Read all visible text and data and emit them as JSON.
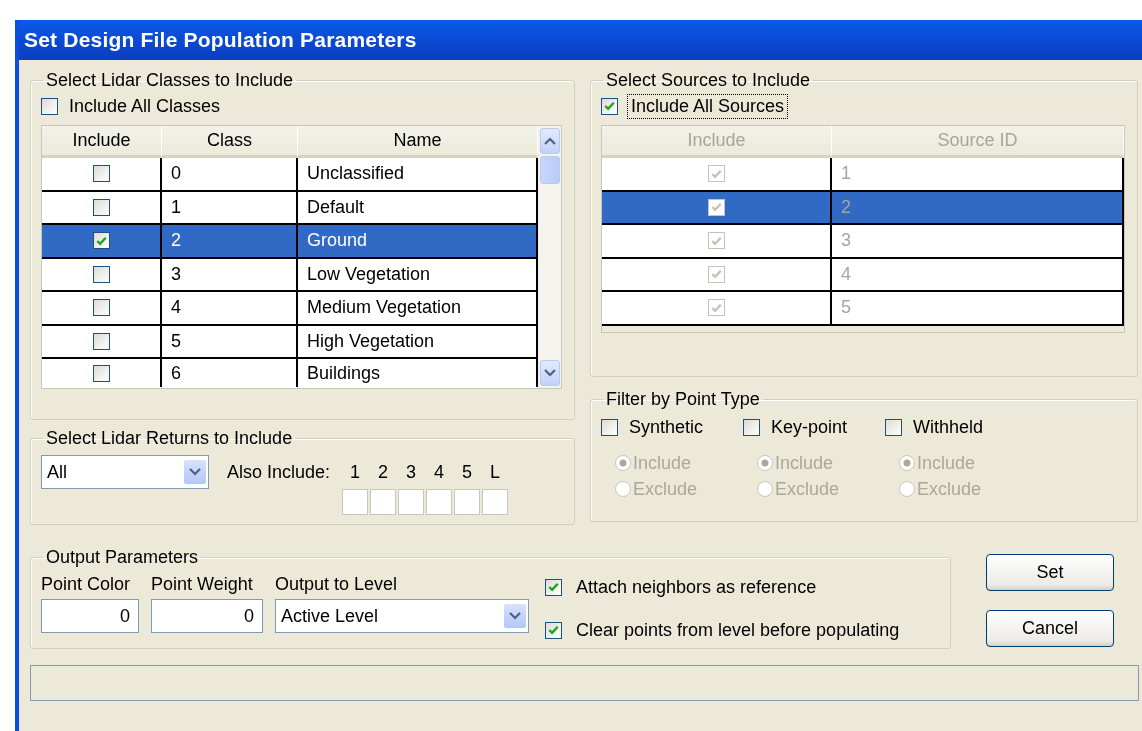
{
  "window": {
    "title": "Set Design File Population Parameters"
  },
  "classes_group": {
    "title": "Select Lidar Classes to Include",
    "include_all": {
      "label": "Include All Classes",
      "checked": false
    },
    "table": {
      "columns": [
        "Include",
        "Class",
        "Name"
      ],
      "rows": [
        {
          "include": false,
          "class": "0",
          "name": "Unclassified",
          "selected": false
        },
        {
          "include": false,
          "class": "1",
          "name": "Default",
          "selected": false
        },
        {
          "include": true,
          "class": "2",
          "name": "Ground",
          "selected": true
        },
        {
          "include": false,
          "class": "3",
          "name": "Low Vegetation",
          "selected": false
        },
        {
          "include": false,
          "class": "4",
          "name": "Medium Vegetation",
          "selected": false
        },
        {
          "include": false,
          "class": "5",
          "name": "High Vegetation",
          "selected": false
        },
        {
          "include": false,
          "class": "6",
          "name": "Buildings",
          "selected": false
        }
      ]
    }
  },
  "sources_group": {
    "title": "Select Sources to Include",
    "include_all": {
      "label": "Include All Sources",
      "checked": true,
      "focused": true
    },
    "table": {
      "disabled": true,
      "columns": [
        "Include",
        "Source ID"
      ],
      "rows": [
        {
          "include": true,
          "source_id": "1",
          "selected": false
        },
        {
          "include": true,
          "source_id": "2",
          "selected": true
        },
        {
          "include": true,
          "source_id": "3",
          "selected": false
        },
        {
          "include": true,
          "source_id": "4",
          "selected": false
        },
        {
          "include": true,
          "source_id": "5",
          "selected": false
        }
      ]
    }
  },
  "returns_group": {
    "title": "Select Lidar Returns to Include",
    "dropdown": {
      "value": "All"
    },
    "also_label": "Also Include:",
    "returns": [
      {
        "label": "1",
        "checked": false,
        "disabled": true
      },
      {
        "label": "2",
        "checked": false,
        "disabled": true
      },
      {
        "label": "3",
        "checked": false,
        "disabled": true
      },
      {
        "label": "4",
        "checked": false,
        "disabled": true
      },
      {
        "label": "5",
        "checked": false,
        "disabled": true
      },
      {
        "label": "L",
        "checked": false,
        "disabled": true
      }
    ]
  },
  "filter_group": {
    "title": "Filter by Point Type",
    "types": [
      {
        "label": "Synthetic",
        "checked": false,
        "options": [
          {
            "label": "Include",
            "selected": true,
            "disabled": true
          },
          {
            "label": "Exclude",
            "selected": false,
            "disabled": true
          }
        ]
      },
      {
        "label": "Key-point",
        "checked": false,
        "options": [
          {
            "label": "Include",
            "selected": true,
            "disabled": true
          },
          {
            "label": "Exclude",
            "selected": false,
            "disabled": true
          }
        ]
      },
      {
        "label": "Withheld",
        "checked": false,
        "options": [
          {
            "label": "Include",
            "selected": true,
            "disabled": true
          },
          {
            "label": "Exclude",
            "selected": false,
            "disabled": true
          }
        ]
      }
    ]
  },
  "output_group": {
    "title": "Output Parameters",
    "fields": [
      {
        "label": "Point Color",
        "value": "0"
      },
      {
        "label": "Point Weight",
        "value": "0"
      }
    ],
    "level": {
      "label": "Output to Level",
      "value": "Active Level"
    },
    "checks": [
      {
        "label": "Attach neighbors as reference",
        "checked": true
      },
      {
        "label": "Clear points from level before populating",
        "checked": true
      }
    ]
  },
  "buttons": [
    "Set",
    "Cancel"
  ]
}
